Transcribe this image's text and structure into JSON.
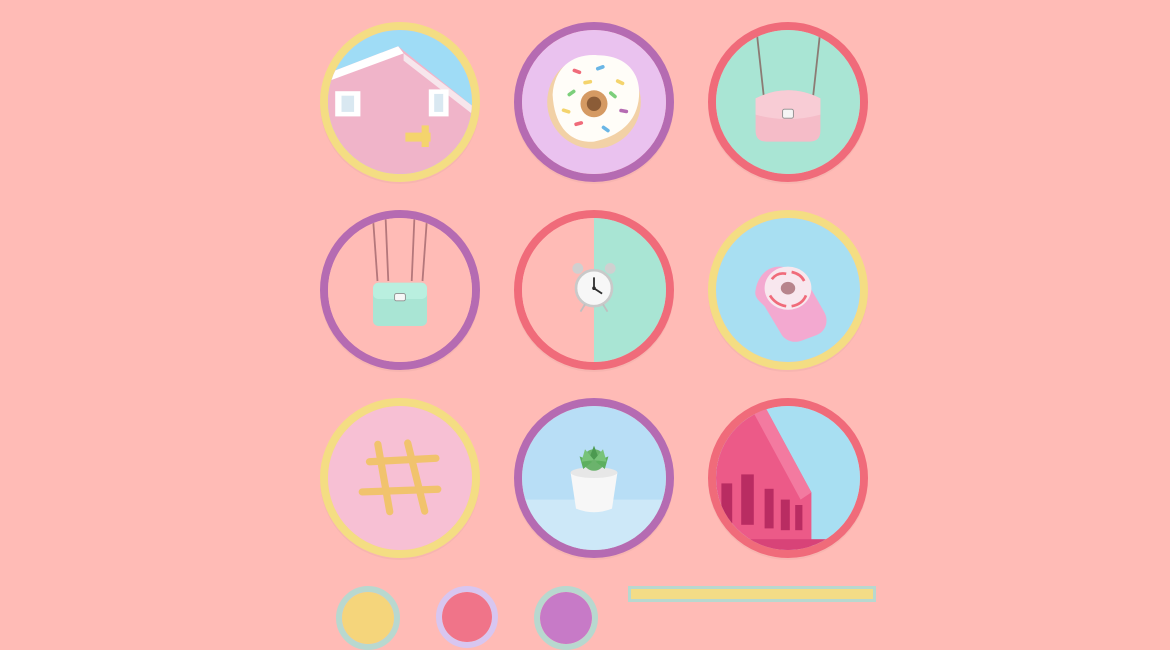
{
  "colors": {
    "background": "#ffbbb6",
    "yellow_ring": "#f4dd83",
    "purple_ring": "#b56bb2",
    "coral_ring": "#f06b7a",
    "mint": "#a9e5d4",
    "sky": "#a8dff2",
    "pink": "#f5b8c7",
    "peach": "#ffb9b2"
  },
  "tiles": [
    {
      "subject": "pink-house-corner",
      "ring": "yellow"
    },
    {
      "subject": "donut-with-sprinkles",
      "ring": "purple"
    },
    {
      "subject": "pink-bag-on-mint-background",
      "ring": "coral"
    },
    {
      "subject": "mint-bag-hanging",
      "ring": "purple"
    },
    {
      "subject": "alarm-clock-split-background",
      "ring": "coral"
    },
    {
      "subject": "glove-holding-donut",
      "ring": "yellow"
    },
    {
      "subject": "pretzel-hashtag",
      "ring": "yellow"
    },
    {
      "subject": "succulent-in-white-pot",
      "ring": "purple"
    },
    {
      "subject": "pink-building-and-sky",
      "ring": "coral"
    }
  ],
  "bottom_row": [
    {
      "subject": "mini-circle-1",
      "ring": "mint"
    },
    {
      "subject": "mini-circle-2",
      "ring": "sky"
    },
    {
      "subject": "mini-circle-3",
      "ring": "mint"
    },
    {
      "subject": "bottom-card",
      "ring": "mint"
    }
  ]
}
